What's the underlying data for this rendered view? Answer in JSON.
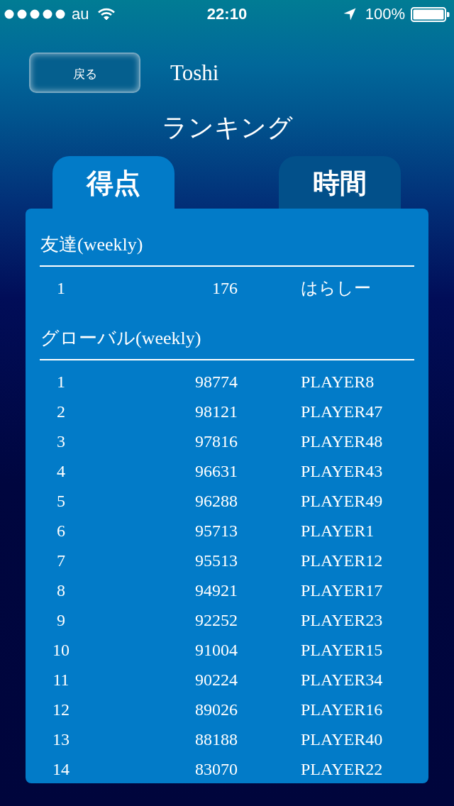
{
  "status_bar": {
    "carrier": "au",
    "time": "22:10",
    "battery": "100%"
  },
  "header": {
    "back_button": "戻る",
    "user_name": "Toshi"
  },
  "title": "ランキング",
  "tabs": [
    {
      "label": "得点",
      "selected": true
    },
    {
      "label": "時間",
      "selected": false
    }
  ],
  "sections": [
    {
      "title": "友達(weekly)",
      "rows": [
        {
          "rank": "1",
          "score": "176",
          "name": "はらしー"
        }
      ]
    },
    {
      "title": "グローバル(weekly)",
      "rows": [
        {
          "rank": "1",
          "score": "98774",
          "name": "PLAYER8"
        },
        {
          "rank": "2",
          "score": "98121",
          "name": "PLAYER47"
        },
        {
          "rank": "3",
          "score": "97816",
          "name": "PLAYER48"
        },
        {
          "rank": "4",
          "score": "96631",
          "name": "PLAYER43"
        },
        {
          "rank": "5",
          "score": "96288",
          "name": "PLAYER49"
        },
        {
          "rank": "6",
          "score": "95713",
          "name": "PLAYER1"
        },
        {
          "rank": "7",
          "score": "95513",
          "name": "PLAYER12"
        },
        {
          "rank": "8",
          "score": "94921",
          "name": "PLAYER17"
        },
        {
          "rank": "9",
          "score": "92252",
          "name": "PLAYER23"
        },
        {
          "rank": "10",
          "score": "91004",
          "name": "PLAYER15"
        },
        {
          "rank": "11",
          "score": "90224",
          "name": "PLAYER34"
        },
        {
          "rank": "12",
          "score": "89026",
          "name": "PLAYER16"
        },
        {
          "rank": "13",
          "score": "88188",
          "name": "PLAYER40"
        },
        {
          "rank": "14",
          "score": "83070",
          "name": "PLAYER22"
        }
      ]
    }
  ]
}
